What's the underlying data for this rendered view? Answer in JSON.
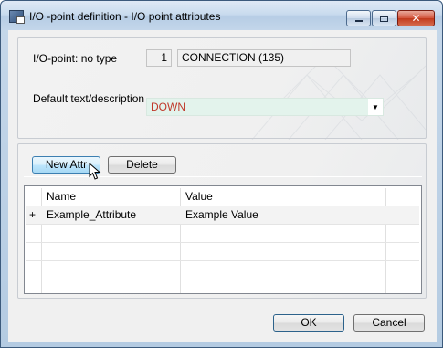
{
  "window": {
    "title": "I/O -point definition - I/O point attributes",
    "close_glyph": "✕"
  },
  "io_point": {
    "label": "I/O-point: no type",
    "number": "1",
    "name": "CONNECTION (135)"
  },
  "default_text": {
    "label": "Default text/description",
    "value": "DOWN",
    "value_color": "#c0392b"
  },
  "attr_toolbar": {
    "new_label": "New Attr",
    "delete_label": "Delete"
  },
  "grid": {
    "columns": [
      "Name",
      "Value"
    ],
    "rows": [
      {
        "marker": "+",
        "name": "Example_Attribute",
        "value": "Example Value"
      }
    ]
  },
  "footer": {
    "ok_label": "OK",
    "cancel_label": "Cancel"
  },
  "colors": {
    "title_bar": "#c9dbee",
    "combo_bg": "#e3f3ec",
    "close_button": "#c23a1c"
  },
  "icons": [
    "app-icon",
    "minimize-icon",
    "maximize-icon",
    "close-icon",
    "dropdown-arrow-icon",
    "mouse-cursor-icon"
  ]
}
